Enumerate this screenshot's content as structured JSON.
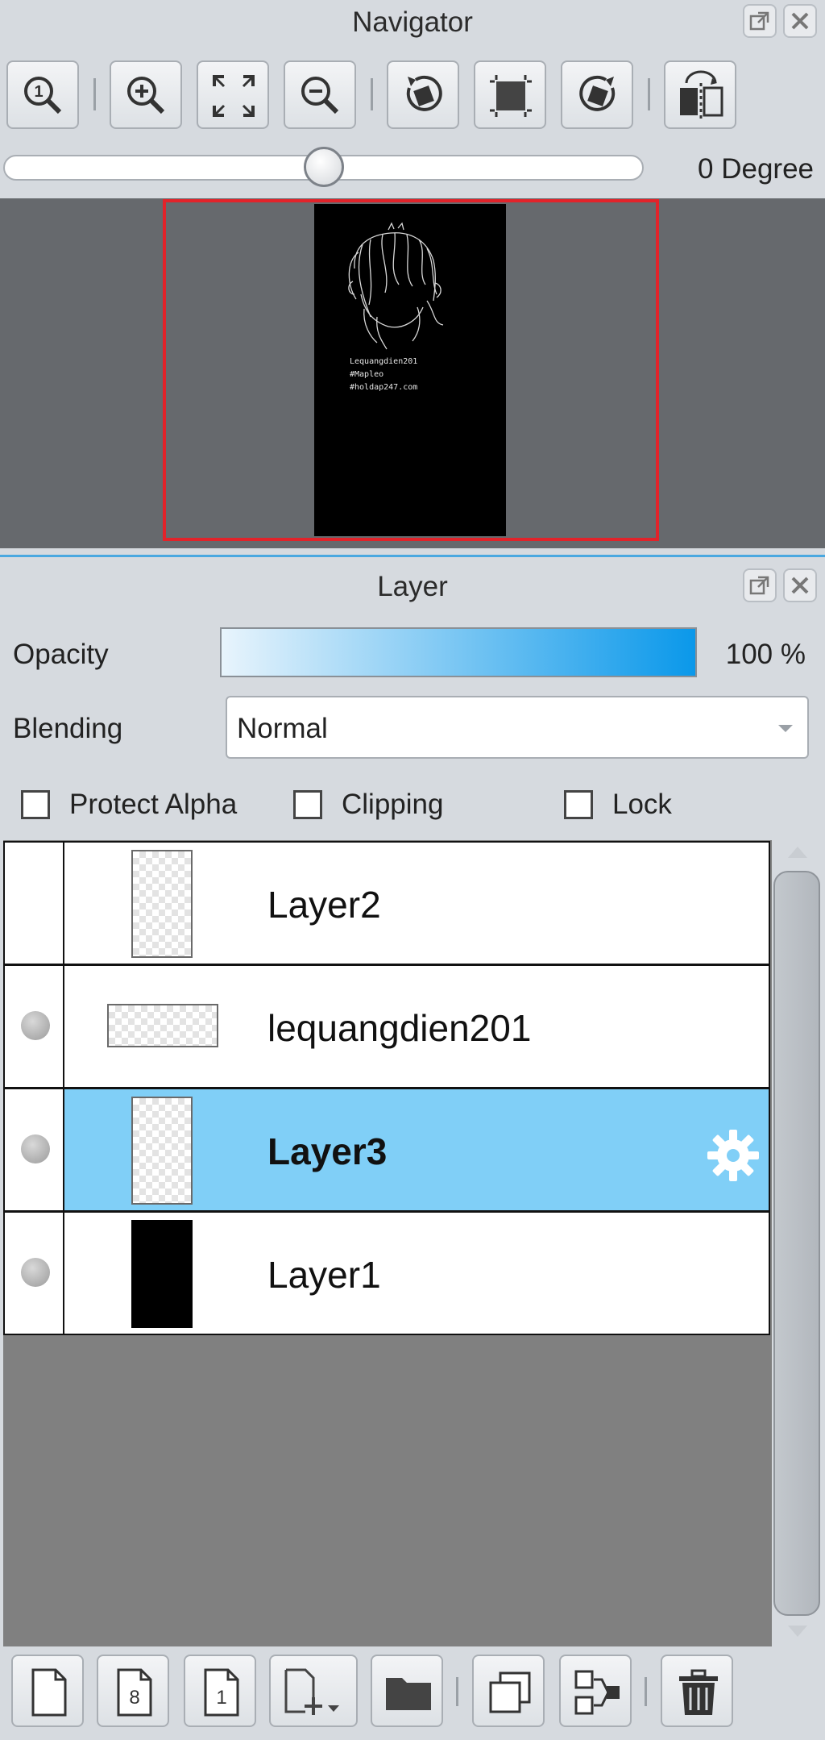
{
  "navigator": {
    "title": "Navigator",
    "tools": [
      {
        "name": "actual-size-icon"
      },
      {
        "name": "zoom-in-icon"
      },
      {
        "name": "fit-window-icon"
      },
      {
        "name": "zoom-out-icon"
      },
      {
        "name": "rotate-left-icon"
      },
      {
        "name": "reset-rotation-icon"
      },
      {
        "name": "rotate-right-icon"
      },
      {
        "name": "flip-horizontal-icon"
      }
    ],
    "rotation": {
      "label": "0 Degree",
      "value": 0,
      "fraction": 0.5
    },
    "preview": {
      "frame_color": "#e2232a",
      "canvas_text": [
        "Lequangdien201",
        "#Mapleo",
        "#holdap247.com"
      ]
    }
  },
  "layer_panel": {
    "title": "Layer",
    "opacity_label": "Opacity",
    "opacity_value": "100 %",
    "opacity_percent": 100,
    "blending_label": "Blending",
    "blending_value": "Normal",
    "checkboxes": {
      "protect_alpha": {
        "label": "Protect Alpha",
        "checked": false
      },
      "clipping": {
        "label": "Clipping",
        "checked": false
      },
      "lock": {
        "label": "Lock",
        "checked": false
      }
    },
    "layers": [
      {
        "name": "Layer2",
        "visible": false,
        "selected": false,
        "thumb": "transparent-portrait"
      },
      {
        "name": "lequangdien201",
        "visible": true,
        "selected": false,
        "thumb": "transparent-landscape"
      },
      {
        "name": "Layer3",
        "visible": true,
        "selected": true,
        "thumb": "transparent-portrait"
      },
      {
        "name": "Layer1",
        "visible": true,
        "selected": false,
        "thumb": "black-portrait"
      }
    ],
    "bottom_tools": [
      {
        "name": "new-raster-layer-icon"
      },
      {
        "name": "new-8bit-layer-icon"
      },
      {
        "name": "new-1bit-layer-icon"
      },
      {
        "name": "add-layer-menu-icon"
      },
      {
        "name": "new-folder-icon"
      },
      {
        "name": "duplicate-layer-icon"
      },
      {
        "name": "merge-down-icon"
      },
      {
        "name": "delete-layer-icon"
      }
    ],
    "selection_color": "#80cff7",
    "accent_color": "#0a98ea"
  }
}
